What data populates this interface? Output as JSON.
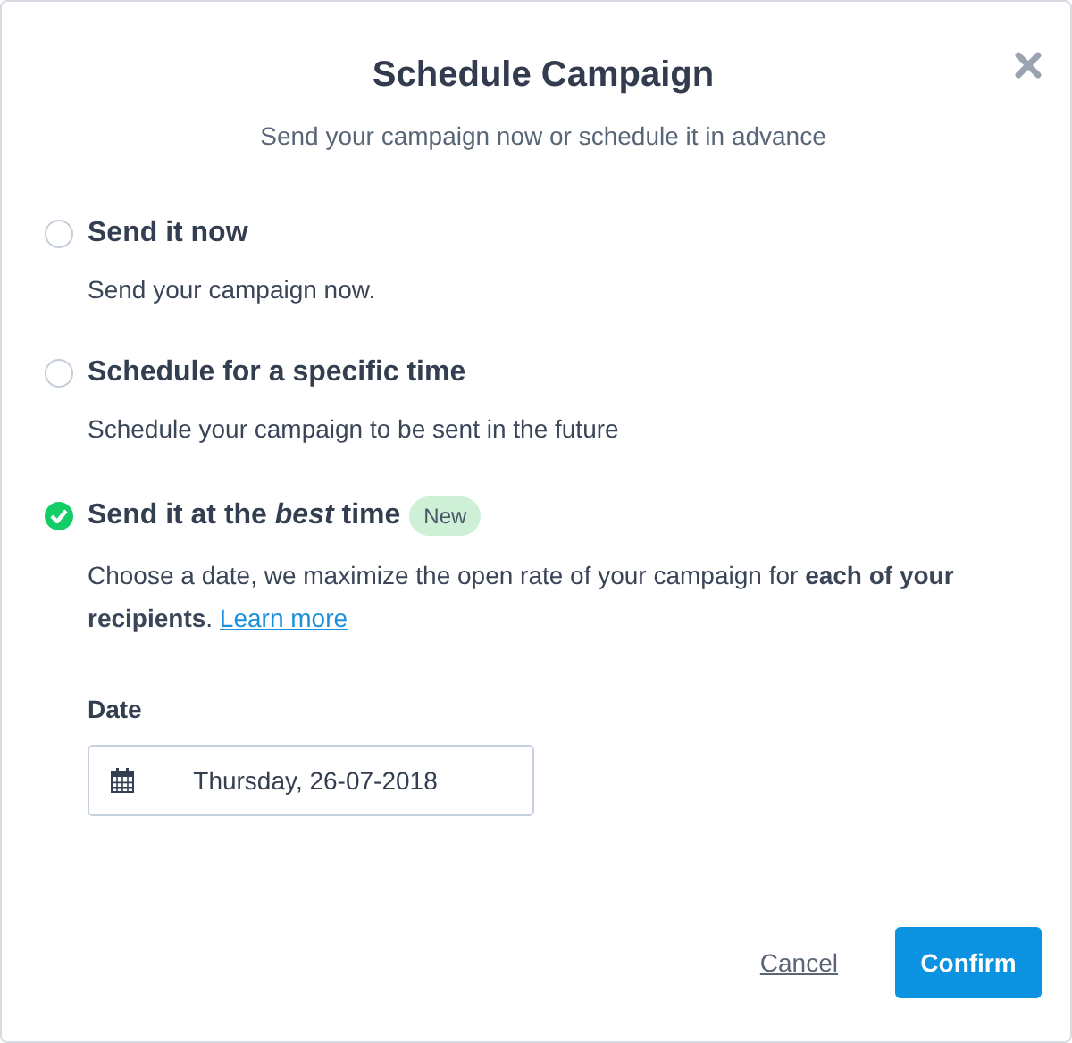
{
  "dialog": {
    "title": "Schedule Campaign",
    "subtitle": "Send your campaign now or schedule it in advance"
  },
  "options": [
    {
      "label": "Send it now",
      "description": "Send your campaign now.",
      "selected": false
    },
    {
      "label": "Schedule for a specific time",
      "description": "Schedule your campaign to be sent in the future",
      "selected": false
    },
    {
      "label": "Send it at the *best* time",
      "badge": "New",
      "description": "Choose a date, we maximize the open rate of your campaign for **each of your recipients**.",
      "link": "Learn more",
      "selected": true
    }
  ],
  "date": {
    "label": "Date",
    "value": "Thursday, 26-07-2018"
  },
  "buttons": {
    "cancel": "Cancel",
    "confirm": "Confirm"
  }
}
